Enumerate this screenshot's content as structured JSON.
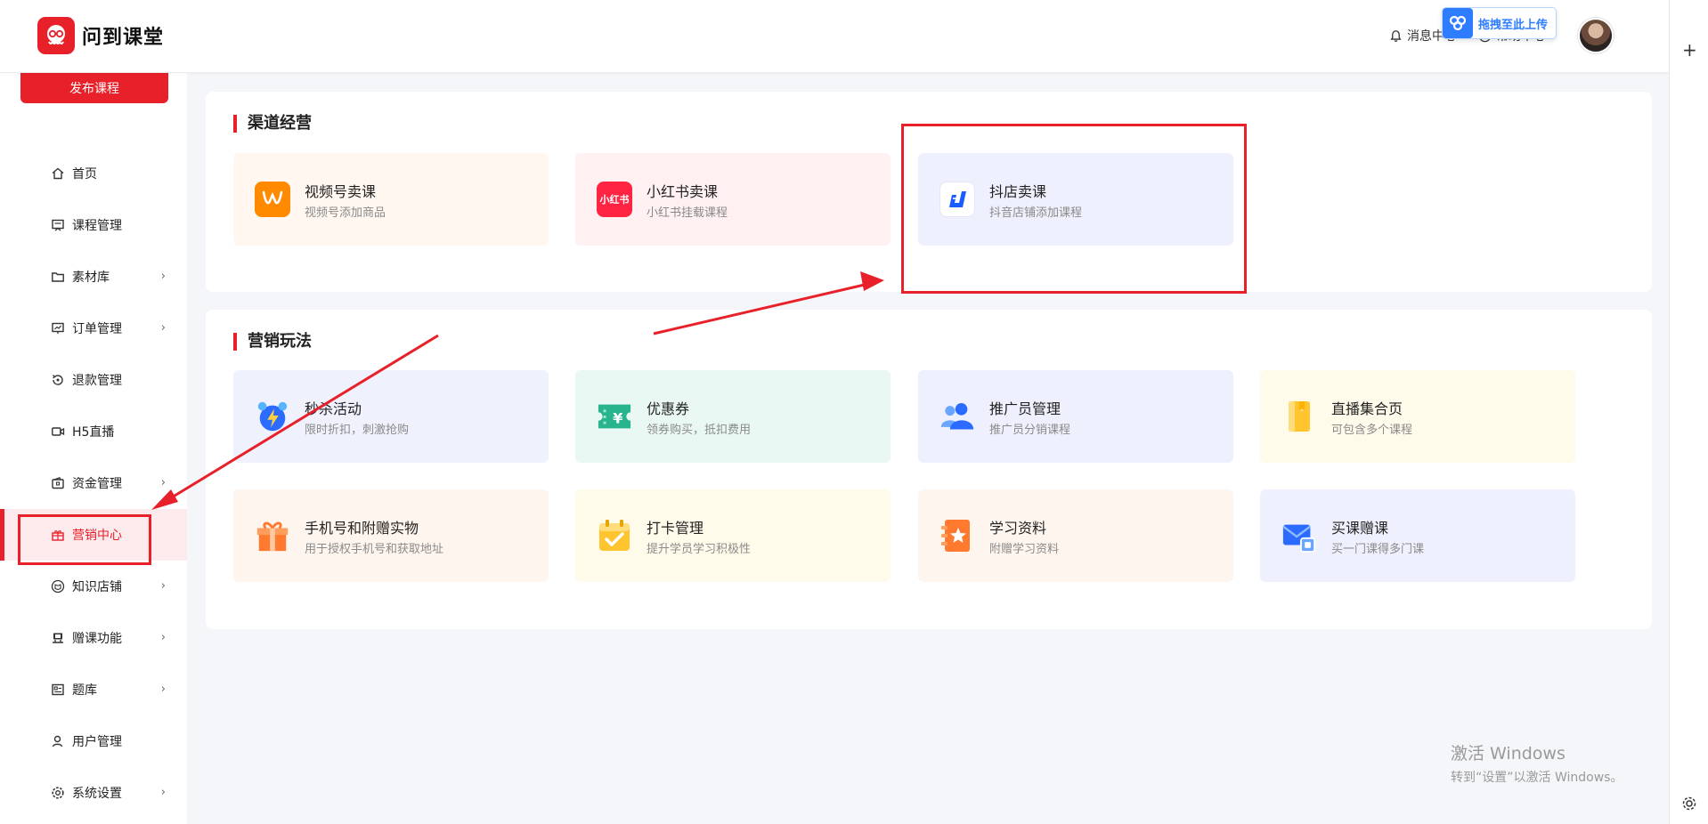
{
  "header": {
    "brand": "问到课堂",
    "messages": "消息中心",
    "help": "帮助中心",
    "upload_badge": "拖拽至此上传"
  },
  "sidebar": {
    "publish_button": "发布课程",
    "items": [
      {
        "label": "首页",
        "icon": "home-icon",
        "chevron": false
      },
      {
        "label": "课程管理",
        "icon": "course-icon",
        "chevron": false
      },
      {
        "label": "素材库",
        "icon": "folder-icon",
        "chevron": true
      },
      {
        "label": "订单管理",
        "icon": "order-icon",
        "chevron": true
      },
      {
        "label": "退款管理",
        "icon": "refund-icon",
        "chevron": false
      },
      {
        "label": "H5直播",
        "icon": "live-icon",
        "chevron": false
      },
      {
        "label": "资金管理",
        "icon": "wallet-icon",
        "chevron": true
      },
      {
        "label": "营销中心",
        "icon": "gift-icon",
        "chevron": false,
        "active": true
      },
      {
        "label": "知识店铺",
        "icon": "shop-icon",
        "chevron": true
      },
      {
        "label": "赠课功能",
        "icon": "present-icon",
        "chevron": true
      },
      {
        "label": "题库",
        "icon": "quiz-icon",
        "chevron": true
      },
      {
        "label": "用户管理",
        "icon": "user-icon",
        "chevron": false
      },
      {
        "label": "系统设置",
        "icon": "settings-icon",
        "chevron": true
      }
    ]
  },
  "channel": {
    "title": "渠道经营",
    "cards": [
      {
        "title": "视频号卖课",
        "desc": "视频号添加商品",
        "icon": "channels-icon",
        "icon_text": ""
      },
      {
        "title": "小红书卖课",
        "desc": "小红书挂载课程",
        "icon": "xiaohongshu-icon",
        "icon_text": "小红书"
      },
      {
        "title": "抖店卖课",
        "desc": "抖音店铺添加课程",
        "icon": "douyin-shop-icon",
        "icon_text": ""
      }
    ]
  },
  "marketing": {
    "title": "营销玩法",
    "cards": [
      {
        "title": "秒杀活动",
        "desc": "限时折扣，刺激抢购",
        "icon": "alarm-clock-icon"
      },
      {
        "title": "优惠券",
        "desc": "领券购买，抵扣费用",
        "icon": "coupon-icon"
      },
      {
        "title": "推广员管理",
        "desc": "推广员分销课程",
        "icon": "promoters-icon"
      },
      {
        "title": "直播集合页",
        "desc": "可包含多个课程",
        "icon": "live-collection-icon"
      },
      {
        "title": "手机号和附赠实物",
        "desc": "用于授权手机号和获取地址",
        "icon": "gift-box-icon"
      },
      {
        "title": "打卡管理",
        "desc": "提升学员学习积极性",
        "icon": "checkin-icon"
      },
      {
        "title": "学习资料",
        "desc": "附赠学习资料",
        "icon": "study-material-icon"
      },
      {
        "title": "买课赠课",
        "desc": "买一门课得多门课",
        "icon": "buy-gift-icon"
      }
    ]
  },
  "watermark": {
    "line1": "激活 Windows",
    "line2": "转到“设置”以激活 Windows。"
  },
  "colors": {
    "brand_red": "#e8202a",
    "annotation_red": "#e8202a"
  }
}
